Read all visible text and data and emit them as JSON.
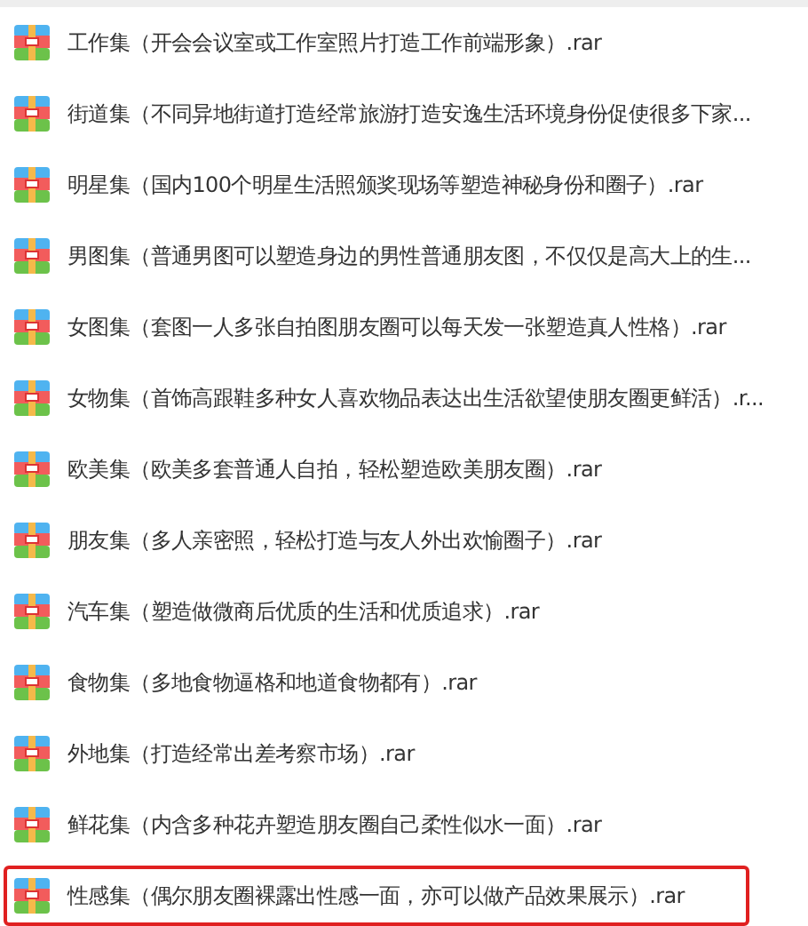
{
  "files": [
    {
      "name": "工作集（开会会议室或工作室照片打造工作前端形象）.rar",
      "highlighted": false
    },
    {
      "name": "街道集（不同异地街道打造经常旅游打造安逸生活环境身份促使很多下家...",
      "highlighted": false
    },
    {
      "name": "明星集（国内100个明星生活照颁奖现场等塑造神秘身份和圈子）.rar",
      "highlighted": false
    },
    {
      "name": "男图集（普通男图可以塑造身边的男性普通朋友图，不仅仅是高大上的生...",
      "highlighted": false
    },
    {
      "name": "女图集（套图一人多张自拍图朋友圈可以每天发一张塑造真人性格）.rar",
      "highlighted": false
    },
    {
      "name": "女物集（首饰高跟鞋多种女人喜欢物品表达出生活欲望使朋友圈更鲜活）.r...",
      "highlighted": false
    },
    {
      "name": "欧美集（欧美多套普通人自拍，轻松塑造欧美朋友圈）.rar",
      "highlighted": false
    },
    {
      "name": "朋友集（多人亲密照，轻松打造与友人外出欢愉圈子）.rar",
      "highlighted": false
    },
    {
      "name": "汽车集（塑造做微商后优质的生活和优质追求）.rar",
      "highlighted": false
    },
    {
      "name": "食物集（多地食物逼格和地道食物都有）.rar",
      "highlighted": false
    },
    {
      "name": "外地集（打造经常出差考察市场）.rar",
      "highlighted": false
    },
    {
      "name": "鲜花集（内含多种花卉塑造朋友圈自己柔性似水一面）.rar",
      "highlighted": false
    },
    {
      "name": "性感集（偶尔朋友圈裸露出性感一面，亦可以做产品效果展示）.rar",
      "highlighted": true
    }
  ]
}
